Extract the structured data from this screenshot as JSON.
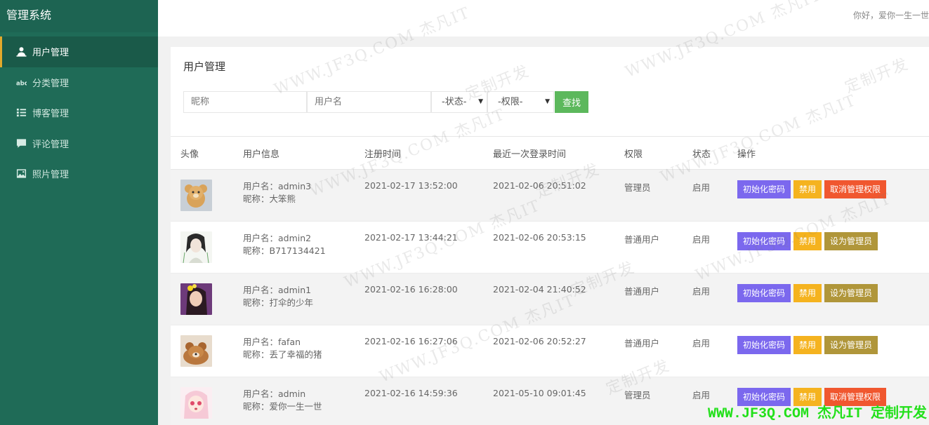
{
  "sidebar": {
    "title": "管理系统",
    "items": [
      {
        "label": "用户管理",
        "icon": "user-icon",
        "active": true
      },
      {
        "label": "分类管理",
        "icon": "abc-icon",
        "active": false
      },
      {
        "label": "博客管理",
        "icon": "list-icon",
        "active": false
      },
      {
        "label": "评论管理",
        "icon": "comment-icon",
        "active": false
      },
      {
        "label": "照片管理",
        "icon": "image-icon",
        "active": false
      }
    ]
  },
  "header": {
    "greeting": "你好，爱你一生一世"
  },
  "panel": {
    "title": "用户管理",
    "filter": {
      "nickname_placeholder": "昵称",
      "username_placeholder": "用户名",
      "status_selected": "-状态-",
      "role_selected": "-权限-",
      "search_label": "查找"
    },
    "table": {
      "columns": [
        "头像",
        "用户信息",
        "注册时间",
        "最近一次登录时间",
        "权限",
        "状态",
        "操作"
      ],
      "rows": [
        {
          "username": "用户名：admin3",
          "nickname": "昵称：大笨熊",
          "registered": "2021-02-17 13:52:00",
          "last_login": "2021-02-06 20:51:02",
          "role": "管理员",
          "status": "启用",
          "actions": [
            "初始化密码",
            "禁用",
            "取消管理权限"
          ]
        },
        {
          "username": "用户名：admin2",
          "nickname": "昵称：B717134421",
          "registered": "2021-02-17 13:44:21",
          "last_login": "2021-02-06 20:53:15",
          "role": "普通用户",
          "status": "启用",
          "actions": [
            "初始化密码",
            "禁用",
            "设为管理员"
          ]
        },
        {
          "username": "用户名：admin1",
          "nickname": "昵称：打伞的少年",
          "registered": "2021-02-16 16:28:00",
          "last_login": "2021-02-04 21:40:52",
          "role": "普通用户",
          "status": "启用",
          "actions": [
            "初始化密码",
            "禁用",
            "设为管理员"
          ]
        },
        {
          "username": "用户名：fafan",
          "nickname": "昵称：丢了幸福的猪",
          "registered": "2021-02-16 16:27:06",
          "last_login": "2021-02-06 20:52:27",
          "role": "普通用户",
          "status": "启用",
          "actions": [
            "初始化密码",
            "禁用",
            "设为管理员"
          ]
        },
        {
          "username": "用户名：admin",
          "nickname": "昵称：爱你一生一世",
          "registered": "2021-02-16 14:59:36",
          "last_login": "2021-05-10 09:01:45",
          "role": "管理员",
          "status": "启用",
          "actions": [
            "初始化密码",
            "禁用",
            "取消管理权限"
          ]
        }
      ]
    }
  },
  "watermark": {
    "text": "WWW.JF3Q.COM 杰凡IT",
    "text2": "定制开发",
    "bottom_text": "WWW.JF3Q.COM 杰凡IT  定制开发"
  },
  "colors": {
    "sidebar_bg": "#1f6b57",
    "active_accent": "#e3a92b",
    "search_button": "#5cb85c",
    "btn_reset": "#7b68ee",
    "btn_disable": "#f5b31f",
    "btn_revoke": "#f0572f",
    "btn_promote": "#b0963a",
    "role_admin": "#2e8b2e",
    "watermark_bottom": "#22e01a"
  }
}
